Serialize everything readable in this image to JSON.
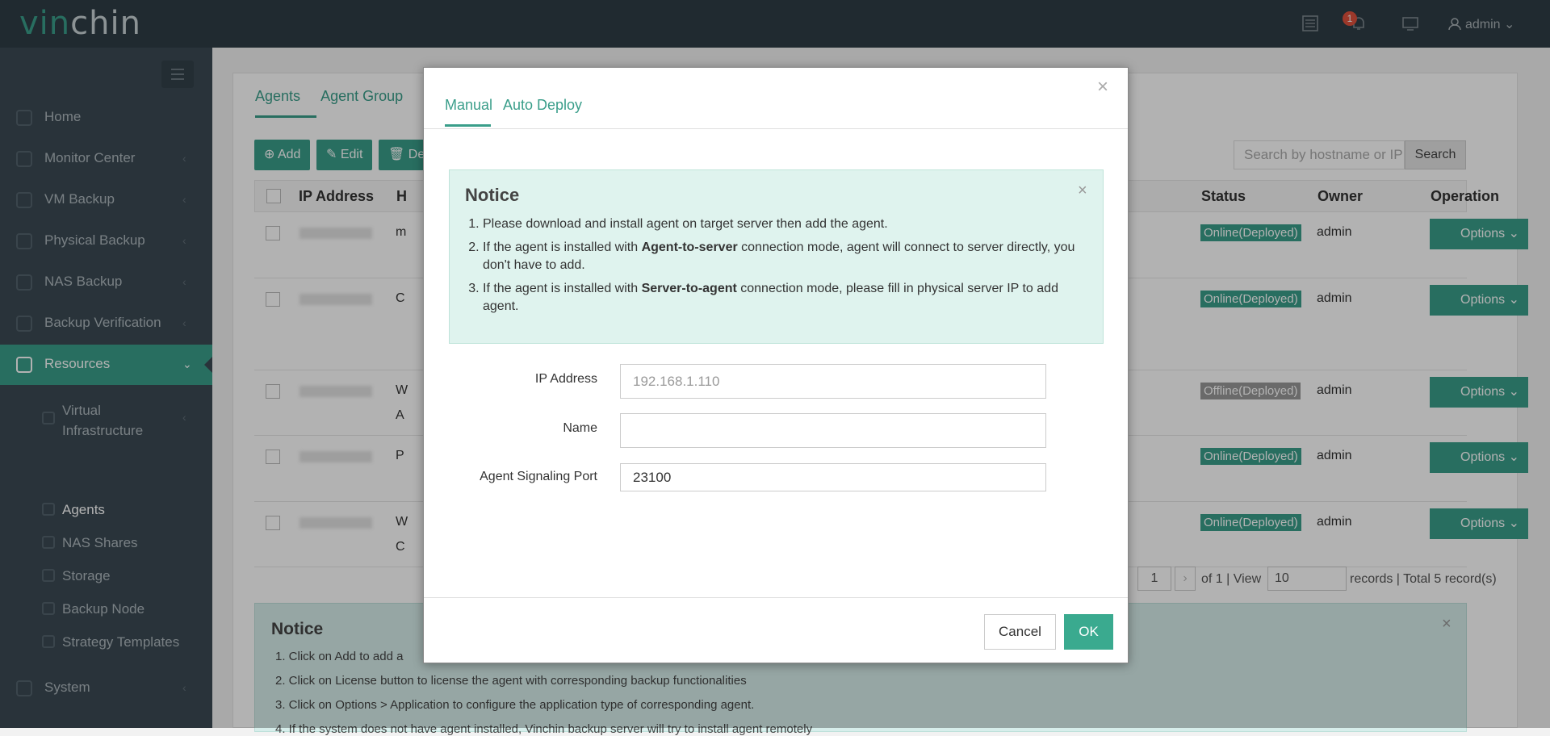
{
  "brand": {
    "logo_a": "vin",
    "logo_b": "chin",
    "accent": "#3a9e8a"
  },
  "topbar": {
    "notification_count": "1",
    "user": "admin ⌄"
  },
  "sidebar": {
    "items": [
      {
        "label": "Home"
      },
      {
        "label": "Monitor Center"
      },
      {
        "label": "VM Backup"
      },
      {
        "label": "Physical Backup"
      },
      {
        "label": "NAS Backup"
      },
      {
        "label": "Backup Verification"
      },
      {
        "label": "Resources"
      },
      {
        "label": "System"
      }
    ],
    "sub": [
      {
        "label": "Virtual Infrastructure"
      },
      {
        "label": "Agents"
      },
      {
        "label": "NAS Shares"
      },
      {
        "label": "Storage"
      },
      {
        "label": "Backup Node"
      },
      {
        "label": "Strategy Templates"
      }
    ]
  },
  "page": {
    "tabs": [
      "Agents",
      "Agent Group"
    ],
    "toolbar": {
      "add": "⊕ Add",
      "edit": "✎ Edit",
      "delete": "🗑 De"
    },
    "search_placeholder": "Search by hostname or IP",
    "search_button": "Search",
    "columns": {
      "ip": "IP Address",
      "h": "H",
      "status": "Status",
      "owner": "Owner",
      "operation": "Operation"
    },
    "rows": [
      {
        "h": "m",
        "status": "Online(Deployed)",
        "owner": "admin",
        "op": "Options ⌄"
      },
      {
        "h": "C",
        "status": "Online(Deployed)",
        "owner": "admin",
        "op": "Options ⌄"
      },
      {
        "h": "W",
        "h2": "A",
        "status": "Offline(Deployed)",
        "owner": "admin",
        "op": "Options ⌄"
      },
      {
        "h": "P",
        "status": "Online(Deployed)",
        "owner": "admin",
        "op": "Options ⌄"
      },
      {
        "h": "W",
        "h2": "C",
        "status": "Online(Deployed)",
        "owner": "admin",
        "op": "Options ⌄"
      }
    ],
    "pager": {
      "page": "1",
      "of": "of 1 | View",
      "per_page": "10",
      "records": "records | Total 5 record(s)"
    },
    "notice": {
      "title": "Notice",
      "lines": [
        "1. Click on Add to add a",
        "2. Click on License button to license the agent with corresponding backup functionalities",
        "3. Click on Options > Application to configure the application type of corresponding agent.",
        "4. If the system does not have agent installed, Vinchin backup server will try to install agent remotely"
      ]
    }
  },
  "modal": {
    "tabs": {
      "manual": "Manual",
      "auto": "Auto Deploy"
    },
    "notice": {
      "title": "Notice",
      "items": [
        {
          "pre": "Please download and install agent on target server then add the agent.",
          "bold": "",
          "post": ""
        },
        {
          "pre": "If the agent is installed with ",
          "bold": "Agent-to-server",
          "post": " connection mode, agent will connect to server directly, you don't have to add."
        },
        {
          "pre": "If the agent is installed with ",
          "bold": "Server-to-agent",
          "post": " connection mode, please fill in physical server IP to add agent."
        }
      ]
    },
    "form": {
      "ip_label": "IP Address",
      "ip_placeholder": "192.168.1.110",
      "ip_value": "",
      "name_label": "Name",
      "name_value": "",
      "port_label": "Agent Signaling Port",
      "port_value": "23100"
    },
    "buttons": {
      "cancel": "Cancel",
      "ok": "OK"
    }
  }
}
